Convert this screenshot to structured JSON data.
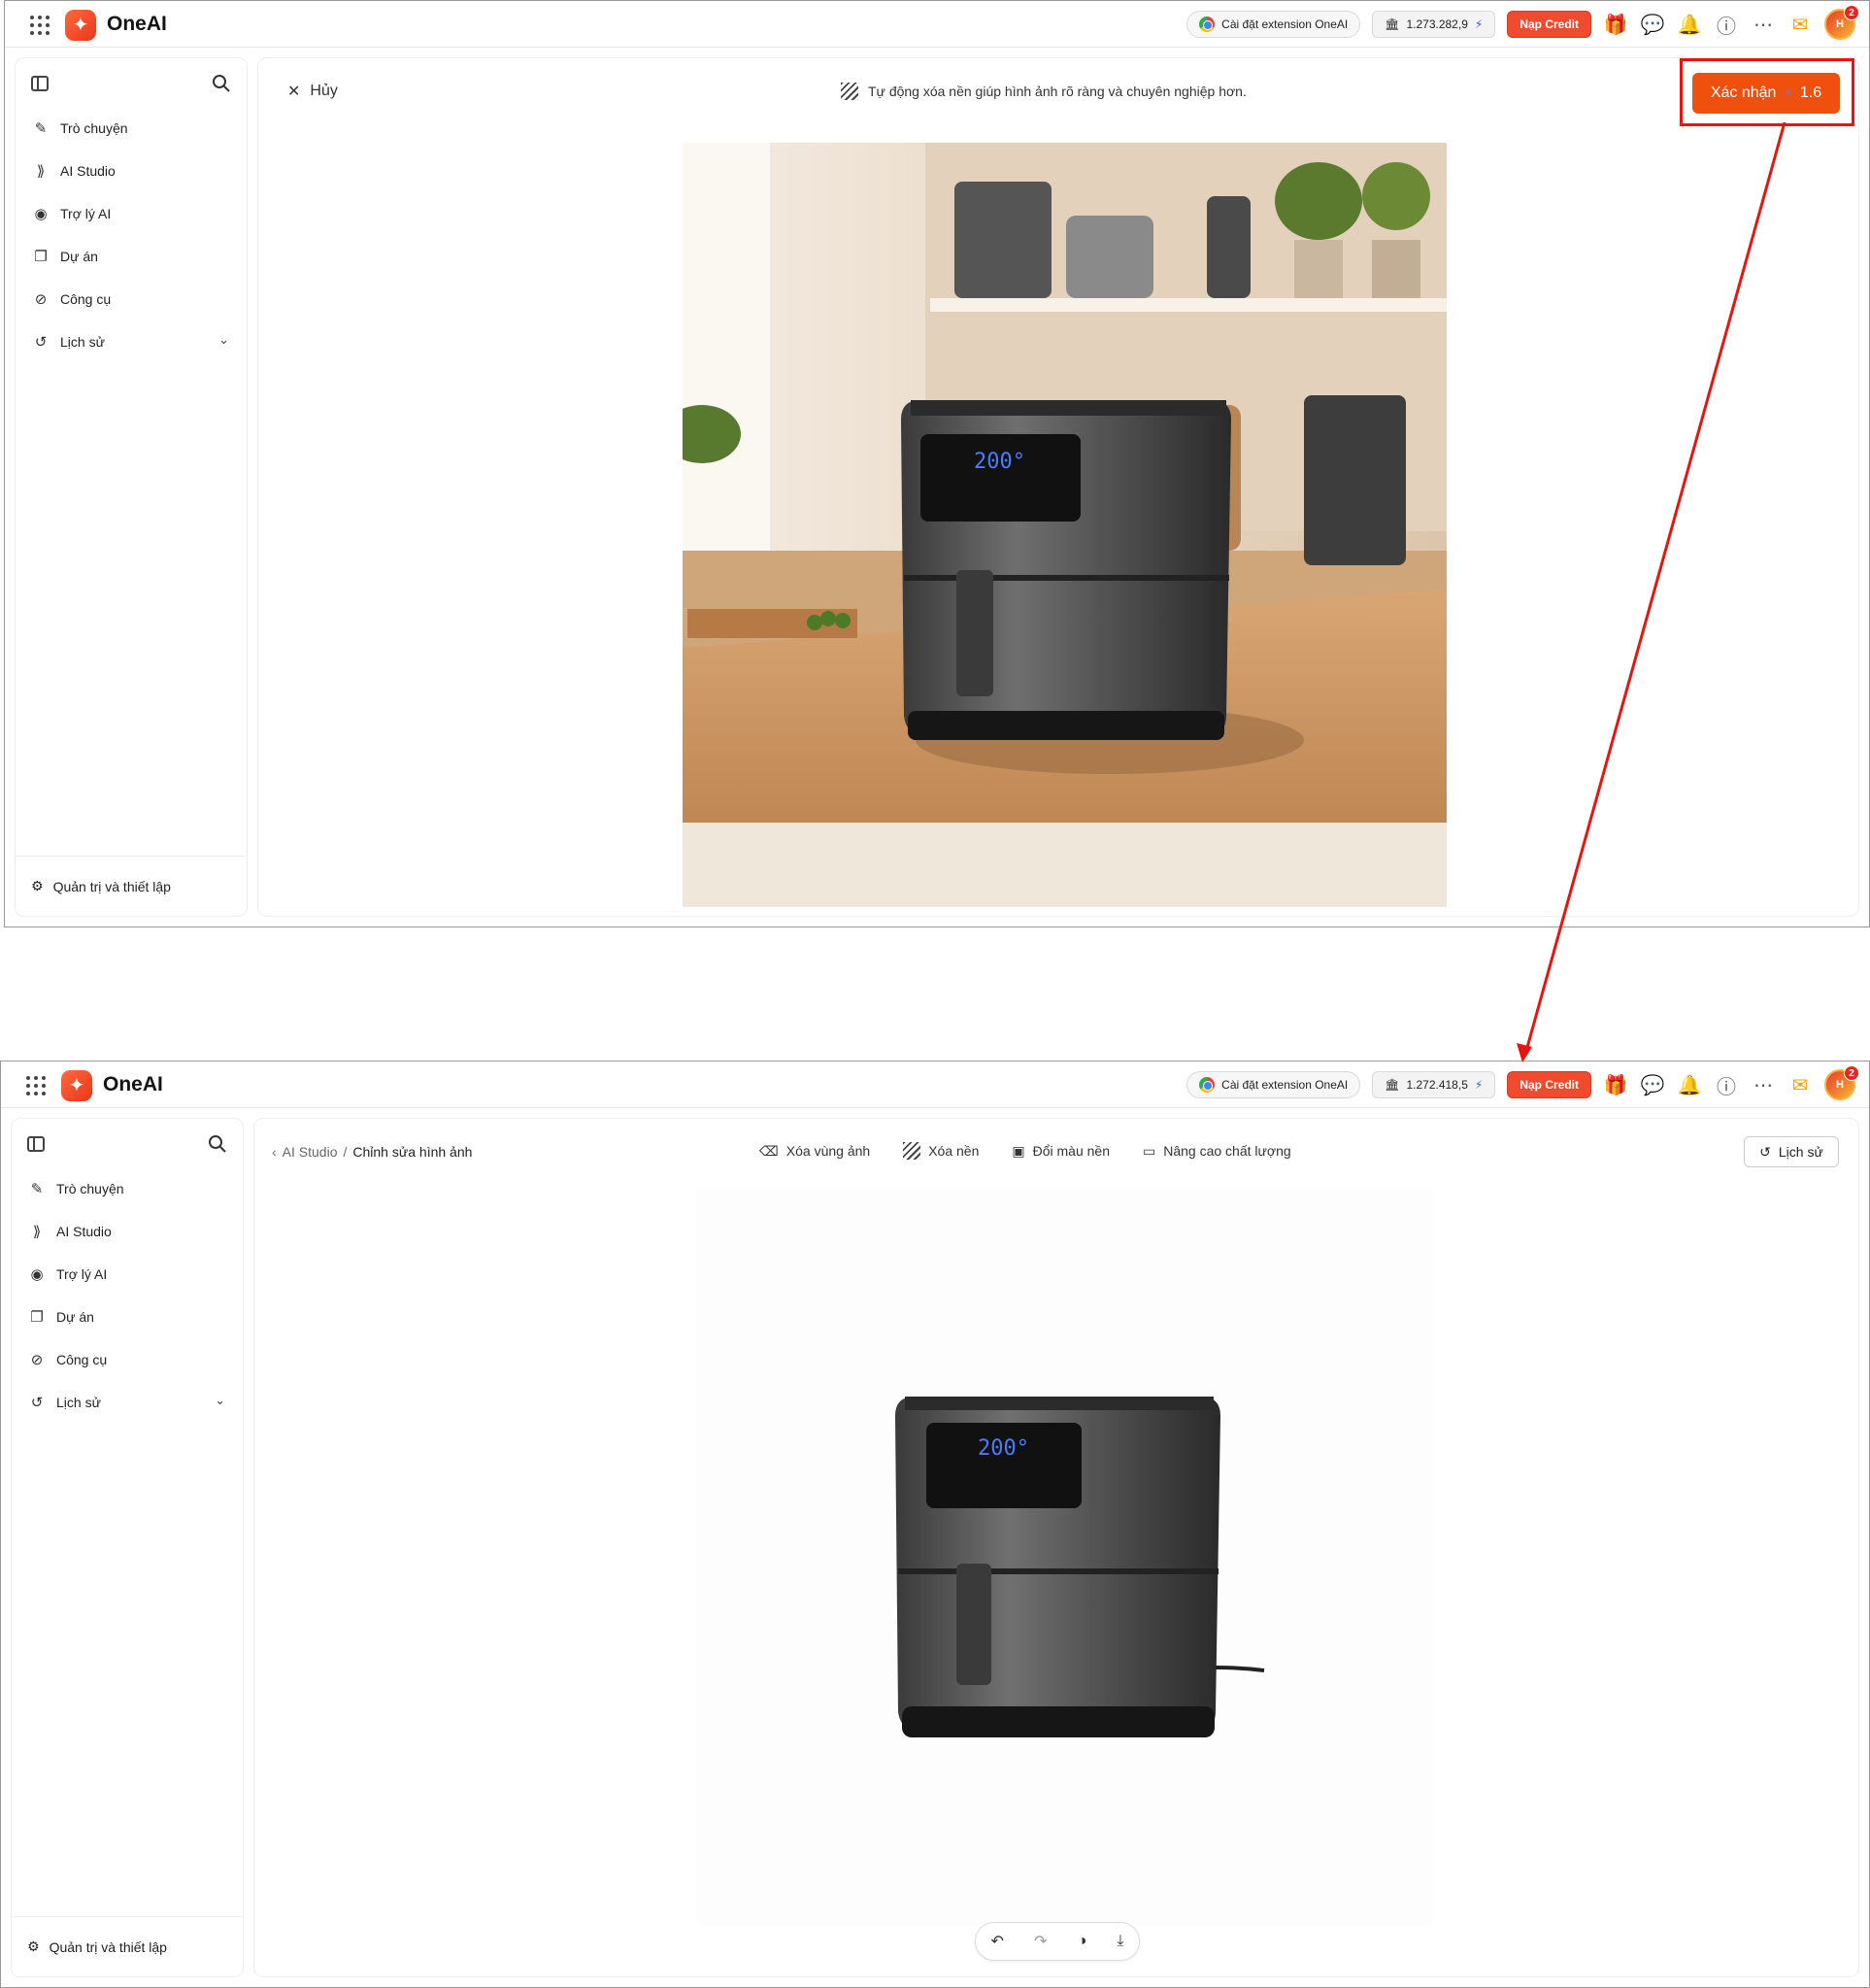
{
  "app": {
    "brand": "OneAI",
    "extension_label": "Cài đặt extension OneAI",
    "topup_label": "Nạp Credit",
    "avatar_initials": "H",
    "notification_count": "2"
  },
  "shots": [
    {
      "credit_balance": "1.273.282,9"
    },
    {
      "credit_balance": "1.272.418,5"
    }
  ],
  "sidebar": {
    "items": [
      {
        "label": "Trò chuyện",
        "icon": "edit-icon"
      },
      {
        "label": "AI Studio",
        "icon": "studio-icon"
      },
      {
        "label": "Trợ lý AI",
        "icon": "bot-icon"
      },
      {
        "label": "Dự án",
        "icon": "folder-icon"
      },
      {
        "label": "Công cụ",
        "icon": "compass-icon"
      },
      {
        "label": "Lịch sử",
        "icon": "history-icon"
      }
    ],
    "settings_label": "Quản trị và thiết lập"
  },
  "editor": {
    "cancel_label": "Hủy",
    "hint": "Tự động xóa nền giúp hình ảnh rõ ràng và chuyên nghiệp hơn.",
    "confirm_label": "Xác nhận",
    "confirm_cost": "1.6",
    "display_temp": "200°"
  },
  "result": {
    "breadcrumb_parent": "AI Studio",
    "breadcrumb_sep": "/",
    "breadcrumb_current": "Chỉnh sửa hình ảnh",
    "tools": [
      "Xóa vùng ảnh",
      "Xóa nền",
      "Đổi màu nền",
      "Nâng cao chất lượng"
    ],
    "history_label": "Lịch sử"
  },
  "colors": {
    "accent": "#f0500e",
    "annotation": "#e8140e"
  }
}
